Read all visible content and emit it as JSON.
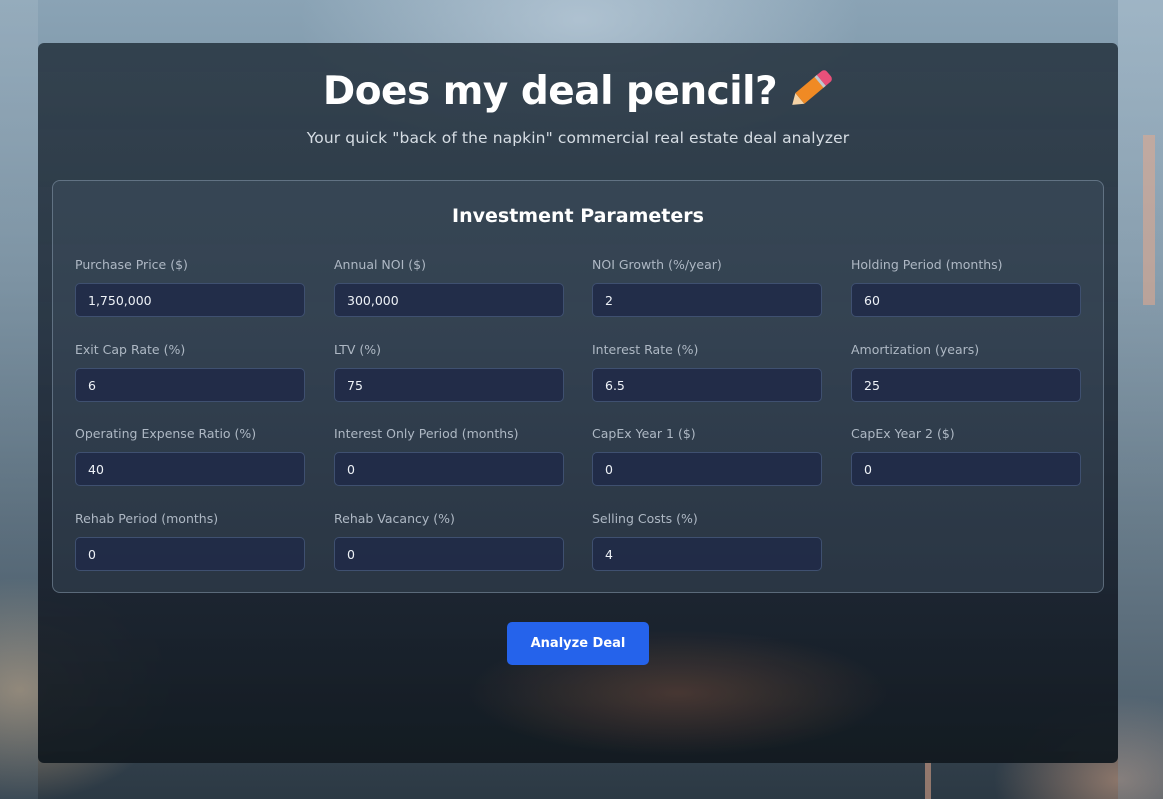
{
  "header": {
    "title": "Does my deal pencil?",
    "title_icon": "pencil-icon",
    "subtitle": "Your quick \"back of the napkin\" commercial real estate deal analyzer"
  },
  "parameters": {
    "title": "Investment Parameters",
    "fields": [
      {
        "label": "Purchase Price ($)",
        "value": "1,750,000"
      },
      {
        "label": "Annual NOI ($)",
        "value": "300,000"
      },
      {
        "label": "NOI Growth (%/year)",
        "value": "2"
      },
      {
        "label": "Holding Period (months)",
        "value": "60"
      },
      {
        "label": "Exit Cap Rate (%)",
        "value": "6"
      },
      {
        "label": "LTV (%)",
        "value": "75"
      },
      {
        "label": "Interest Rate (%)",
        "value": "6.5"
      },
      {
        "label": "Amortization (years)",
        "value": "25"
      },
      {
        "label": "Operating Expense Ratio (%)",
        "value": "40"
      },
      {
        "label": "Interest Only Period (months)",
        "value": "0"
      },
      {
        "label": "CapEx Year 1 ($)",
        "value": "0"
      },
      {
        "label": "CapEx Year 2 ($)",
        "value": "0"
      },
      {
        "label": "Rehab Period (months)",
        "value": "0"
      },
      {
        "label": "Rehab Vacancy (%)",
        "value": "0"
      },
      {
        "label": "Selling Costs (%)",
        "value": "4"
      }
    ]
  },
  "actions": {
    "analyze_label": "Analyze Deal"
  },
  "colors": {
    "primary_button": "#2563eb",
    "input_background": "#202a48",
    "label_text": "#aeb8c4"
  }
}
